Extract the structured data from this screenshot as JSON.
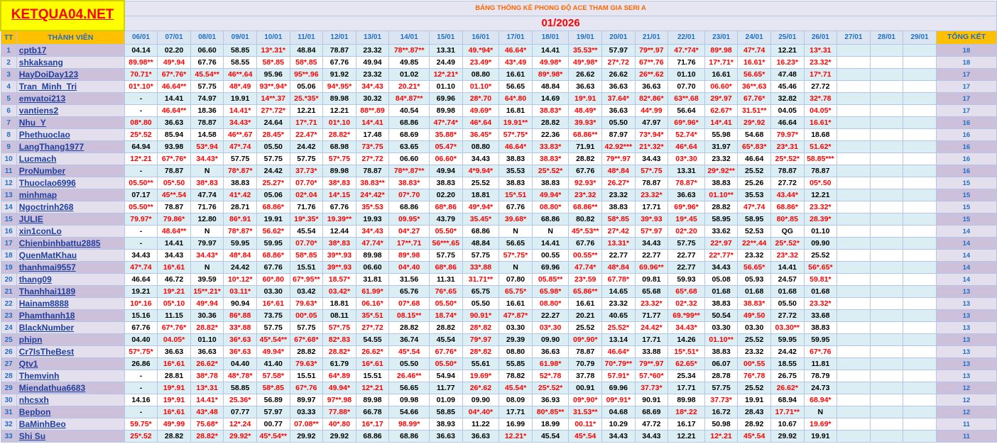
{
  "logo_text": "KETQUA04.NET",
  "sheet_title": "BẢNG THỐNG KÊ PHONG ĐỘ ACE THAM GIA SERI A",
  "month": "01/2026",
  "headers": {
    "tt": "TT",
    "member": "THÀNH VIÊN",
    "total": "TỔNG KẾT"
  },
  "dates": [
    "06/01",
    "07/01",
    "08/01",
    "09/01",
    "10/01",
    "11/01",
    "12/01",
    "13/01",
    "14/01",
    "15/01",
    "16/01",
    "17/01",
    "18/01",
    "19/01",
    "20/01",
    "21/01",
    "22/01",
    "23/01",
    "24/01",
    "25/01",
    "26/01",
    "27/01",
    "28/01",
    "29/01"
  ],
  "rows": [
    {
      "tt": "1",
      "name": "cptb17",
      "cells": [
        "04.14",
        "02.20",
        "06.60",
        "58.85",
        "13*.31*",
        "48.84",
        "78.87",
        "23.32",
        "78**.87**",
        "13.31",
        "49.*94*",
        "46.64*",
        "14.41",
        "35.53**",
        "57.97",
        "79**.97",
        "47.*74*",
        "89*.98",
        "47*.74",
        "12.21",
        "13*.31",
        "",
        "",
        ""
      ],
      "total": "18"
    },
    {
      "tt": "2",
      "name": "shkaksang",
      "cells": [
        "89.98**",
        "49*.94",
        "67.76",
        "58.55",
        "58*.85",
        "58*.85",
        "67.76",
        "49.94",
        "49.85",
        "24.49",
        "23.49*",
        "43*.49",
        "49.98*",
        "49*.98*",
        "27*.72",
        "67**.76",
        "71.76",
        "17*.71*",
        "16.61*",
        "16.23*",
        "23.32*",
        "",
        "",
        ""
      ],
      "total": "18"
    },
    {
      "tt": "3",
      "name": "HayDoiDay123",
      "cells": [
        "70.71*",
        "67*.76*",
        "45.54**",
        "46**.64",
        "95.96",
        "95**.96",
        "91.92",
        "23.32",
        "01.02",
        "12*.21*",
        "08.80",
        "16.61",
        "89*.98*",
        "26.62",
        "26.62",
        "26**.62",
        "01.10",
        "16.61",
        "56.65*",
        "47.48",
        "17*.71",
        "",
        "",
        ""
      ],
      "total": "17"
    },
    {
      "tt": "4",
      "name": "Tran_Minh_Tri",
      "cells": [
        "01*.10*",
        "46.64**",
        "57.75",
        "48*.49",
        "93**.94*",
        "05.06",
        "94*.95*",
        "34*.43",
        "20.21*",
        "01.10",
        "01.10*",
        "56.65",
        "48.84",
        "36.63",
        "36.63",
        "36.63",
        "07.70",
        "06.60*",
        "36**.63",
        "45.46",
        "27.72",
        "",
        "",
        ""
      ],
      "total": "17"
    },
    {
      "tt": "5",
      "name": "emvatoi213",
      "cells": [
        "-",
        "14.41",
        "74.97",
        "19.91",
        "14**.37",
        "25.*35*",
        "89.98",
        "30.32",
        "84*.87**",
        "69.96",
        "28*.70",
        "64*.80",
        "14.69",
        "19*.91",
        "37.64*",
        "82*.86*",
        "63**.68",
        "29*.97",
        "67.76*",
        "32.82",
        "32*.78",
        "",
        "",
        ""
      ],
      "total": "17"
    },
    {
      "tt": "6",
      "name": "vantiens2",
      "cells": [
        "-",
        "46.64**",
        "18.36",
        "14.41*",
        "27*.72*",
        "12.21",
        "12.21",
        "88**.89",
        "40.54",
        "89.98",
        "49.69*",
        "16.81",
        "38.83*",
        "48.49*",
        "36.63",
        "44*.99",
        "56.64",
        "62.67*",
        "31.51**",
        "04.05",
        "04.05*",
        "",
        "",
        ""
      ],
      "total": "17"
    },
    {
      "tt": "7",
      "name": "Nhu_Y",
      "cells": [
        "08*.80",
        "36.63",
        "78.87",
        "34.43*",
        "24.64",
        "17*.71",
        "01*.10",
        "14*.41",
        "68.86",
        "47*.74*",
        "46*.64",
        "19.91**",
        "28.82",
        "39.93*",
        "05.50",
        "47.97",
        "69*.96*",
        "14*.41",
        "29*.92",
        "46.64",
        "16.61*",
        "",
        "",
        ""
      ],
      "total": "16"
    },
    {
      "tt": "8",
      "name": "Phethuoclao",
      "cells": [
        "25*.52",
        "85.94",
        "14.58",
        "46**.67",
        "28.45*",
        "22.47*",
        "28.82*",
        "17.48",
        "68.69",
        "35.88*",
        "36.45*",
        "57*.75*",
        "22.36",
        "68.86**",
        "87.97",
        "73*.94*",
        "52.74*",
        "55.98",
        "54.68",
        "79.97*",
        "18.68",
        "",
        "",
        ""
      ],
      "total": "16"
    },
    {
      "tt": "9",
      "name": "LangThang1977",
      "cells": [
        "64.94",
        "93.98",
        "53*.94",
        "47*.74",
        "05.50",
        "24.42",
        "68.98",
        "73*.75",
        "63.65",
        "05.47*",
        "08.80",
        "46.64*",
        "33.83*",
        "71.91",
        "42.92***",
        "21*.32*",
        "46*.64",
        "31.97",
        "65*.83*",
        "23*.31",
        "51.62*",
        "",
        "",
        ""
      ],
      "total": "16"
    },
    {
      "tt": "10",
      "name": "Lucmach",
      "cells": [
        "12*.21",
        "67*.76*",
        "34.43*",
        "57.75",
        "57.75",
        "57.75",
        "57*.75",
        "27*.72",
        "06.60",
        "06.60*",
        "34.43",
        "38.83",
        "38.83*",
        "28.82",
        "79**.97",
        "34.43",
        "03*.30",
        "23.32",
        "46.64",
        "25*.52*",
        "58.85***",
        "",
        "",
        ""
      ],
      "total": "16"
    },
    {
      "tt": "11",
      "name": "ProNumber",
      "cells": [
        "-",
        "78.87",
        "N",
        "78*.87*",
        "24.42",
        "37.73*",
        "89.98",
        "78.87",
        "78**.87**",
        "49.94",
        "4*9.94*",
        "35.53",
        "25*.52*",
        "67.76",
        "48*.84",
        "57*.75",
        "13.31",
        "29*.92**",
        "25.52",
        "78.87",
        "78.87",
        "",
        "",
        ""
      ],
      "total": "16"
    },
    {
      "tt": "12",
      "name": "Thuoclao6996",
      "cells": [
        "05.50**",
        "05*.50",
        "38*.83",
        "38.83",
        "25.27*",
        "07.70*",
        "38*.83",
        "38.83**",
        "38.83*",
        "38.83",
        "25.52",
        "38.83",
        "38.83",
        "92.93*",
        "26.27*",
        "78.87",
        "78.87*",
        "38.83",
        "25.26",
        "27.72",
        "05*.50",
        "",
        "",
        ""
      ],
      "total": "15"
    },
    {
      "tt": "13",
      "name": "minhmap",
      "cells": [
        "07.17",
        "45**.54",
        "47.74",
        "41*.42",
        "05.06",
        "02*.04",
        "14*.15",
        "24*.42*",
        "07*.70",
        "02.20",
        "18.81",
        "15*.51",
        "49.94*",
        "23*.32",
        "23.32",
        "23.32*",
        "36.63",
        "01.10**",
        "35.53",
        "43.44*",
        "12.21",
        "",
        "",
        ""
      ],
      "total": "15"
    },
    {
      "tt": "14",
      "name": "Ngoctrinh268",
      "cells": [
        "05.50**",
        "78.87",
        "71.76",
        "28.71",
        "68.86*",
        "71.76",
        "67.76",
        "35*.53",
        "68.86",
        "68*.86",
        "49*.94*",
        "67.76",
        "08.80*",
        "68.86**",
        "38.83",
        "17.71",
        "69*.96*",
        "28.82",
        "47*.74",
        "68.86*",
        "23.32*",
        "",
        "",
        ""
      ],
      "total": "15"
    },
    {
      "tt": "15",
      "name": "JULIE",
      "cells": [
        "79.97*",
        "79.86*",
        "12.80",
        "86*.91",
        "19.91",
        "19*.35*",
        "19.39**",
        "19.93",
        "09.95*",
        "43.79",
        "35.45*",
        "39.68*",
        "68.86",
        "80.82",
        "58*.85",
        "39*.93",
        "19*.45",
        "58.95",
        "58.95",
        "80*.85",
        "28.39*",
        "",
        "",
        ""
      ],
      "total": "15"
    },
    {
      "tt": "16",
      "name": "xin1conLo",
      "cells": [
        "-",
        "48.64**",
        "N",
        "78*.87*",
        "56.62*",
        "45.54",
        "12.44",
        "34*.43",
        "04*.27",
        "05.50*",
        "68.86",
        "N",
        "N",
        "45*.53**",
        "27*.42",
        "57*.97",
        "02*.20",
        "33.62",
        "52.53",
        "QG",
        "01.10",
        "",
        "",
        ""
      ],
      "total": "14"
    },
    {
      "tt": "17",
      "name": "Chienbinhbattu2885",
      "cells": [
        "-",
        "14.41",
        "79.97",
        "59.95",
        "59.95",
        "07.70*",
        "38*.83",
        "47.74*",
        "17**.71",
        "56***.65",
        "48.84",
        "56.65",
        "14.41",
        "67.76",
        "13.31*",
        "34.43",
        "57.75",
        "22*.97",
        "22**.44",
        "25*.52*",
        "09.90",
        "",
        "",
        ""
      ],
      "total": "14"
    },
    {
      "tt": "18",
      "name": "QuenMatKhau",
      "cells": [
        "34.43",
        "34.43",
        "34.43*",
        "48*.84",
        "68.86*",
        "58*.85",
        "39**.93",
        "89.98",
        "89*.98",
        "57.75",
        "57.75",
        "57*.75*",
        "00.55",
        "00.55**",
        "22.77",
        "22.77",
        "22.77",
        "22*.77*",
        "23.32",
        "23*.32",
        "25.52",
        "",
        "",
        ""
      ],
      "total": "14"
    },
    {
      "tt": "19",
      "name": "thanhmai9557",
      "cells": [
        "47*.74",
        "16*.61",
        "N",
        "24.42",
        "67.76",
        "15.51",
        "39**.93",
        "06.60",
        "04*.40",
        "68*.86",
        "33*.88",
        "N",
        "69.96",
        "47.74*",
        "48*.84",
        "69.96**",
        "22.77",
        "34.43",
        "56.65*",
        "14.41",
        "56*.65*",
        "",
        "",
        ""
      ],
      "total": "14"
    },
    {
      "tt": "20",
      "name": "thang09",
      "cells": [
        "46.64",
        "46.72",
        "39.59",
        "10*.12*",
        "60*.80",
        "67*.95**",
        "18.57*",
        "31.81",
        "31.56",
        "11.31",
        "31.71**",
        "07.80",
        "05.85**",
        "23*.59",
        "67.78*",
        "09.81",
        "59.93",
        "05.08",
        "05.93",
        "24.57",
        "59.81*",
        "",
        "",
        ""
      ],
      "total": "14"
    },
    {
      "tt": "21",
      "name": "Thanhhai1189",
      "cells": [
        "19.21",
        "19*.21",
        "15**.21*",
        "03.11*",
        "03.30",
        "03.42",
        "03.42*",
        "61.99*",
        "65.76",
        "76*.65",
        "65.75",
        "65.75*",
        "65.98*",
        "65.86**",
        "14.65",
        "65.68",
        "65*.68",
        "01.68",
        "01.68",
        "01.68",
        "01.68",
        "",
        "",
        ""
      ],
      "total": "13"
    },
    {
      "tt": "22",
      "name": "Hainam8888",
      "cells": [
        "10*.16",
        "05*.10",
        "49*.94",
        "90.94",
        "16*.61",
        "79.63*",
        "18.81",
        "06.16*",
        "07*.68",
        "05.50*",
        "05.50",
        "16.61",
        "08.80*",
        "16.61",
        "23.32",
        "23.32*",
        "02*.32",
        "38.83",
        "38.83*",
        "05.50",
        "23.32*",
        "",
        "",
        ""
      ],
      "total": "13"
    },
    {
      "tt": "23",
      "name": "Phamthanh18",
      "cells": [
        "15.16",
        "11.15",
        "30.36",
        "86*.88",
        "73.75",
        "00*.05",
        "08.11",
        "35*.51",
        "08.15**",
        "18.74*",
        "90.91*",
        "47*.87*",
        "22.27",
        "20.21",
        "40.65",
        "71.77",
        "69.*99**",
        "50.54",
        "49*.50",
        "27.72",
        "33.68",
        "",
        "",
        ""
      ],
      "total": "13"
    },
    {
      "tt": "24",
      "name": "BlackNumber",
      "cells": [
        "67.76",
        "67*.76*",
        "28.82*",
        "33*.88",
        "57.75",
        "57.75",
        "57*.75",
        "27*.72",
        "28.82",
        "28.82",
        "28*.82",
        "03.30",
        "03*.30",
        "25.52",
        "25.52*",
        "24.42*",
        "34.43*",
        "03.30",
        "03.30",
        "03.30**",
        "38.83",
        "",
        "",
        ""
      ],
      "total": "13"
    },
    {
      "tt": "25",
      "name": "phipn",
      "cells": [
        "04.40",
        "04.05*",
        "01.10",
        "36*.63",
        "45*.54**",
        "67*.68*",
        "82*.83",
        "54.55",
        "36.74",
        "45.54",
        "79*.97",
        "29.39",
        "09.90",
        "09*.90*",
        "13.14",
        "17.71",
        "14.26",
        "01.10**",
        "25.52",
        "59.95",
        "59.95",
        "",
        "",
        ""
      ],
      "total": "13"
    },
    {
      "tt": "26",
      "name": "Cr7IsTheBest",
      "cells": [
        "57*.75*",
        "36.63",
        "36.63",
        "36*.63",
        "49.94*",
        "28.82",
        "28.82*",
        "26.62*",
        "45*.54",
        "67.76*",
        "28*.82",
        "08.80",
        "36.63",
        "78.87",
        "46.64*",
        "33.88",
        "15*.51*",
        "38.83",
        "23.32",
        "24.42",
        "67*.76",
        "",
        "",
        ""
      ],
      "total": "13"
    },
    {
      "tt": "27",
      "name": "Qtv1",
      "cells": [
        "26.86",
        "16*.61",
        "26.62*",
        "04.40",
        "41.40",
        "79.63*",
        "61.79",
        "16*.61",
        "05.50",
        "05.50*",
        "55.61",
        "55.85",
        "61.98*",
        "70.79",
        "70*.79**",
        "79**.97",
        "62.65*",
        "06.07",
        "00*.55",
        "18.55",
        "11.81",
        "",
        "",
        ""
      ],
      "total": "13"
    },
    {
      "tt": "28",
      "name": "Themvinh",
      "cells": [
        "-",
        "28.81",
        "38*.78",
        "48*.78*",
        "57.58*",
        "15.51",
        "64*.89",
        "15.51",
        "26.46**",
        "54.94",
        "19.69*",
        "78.82",
        "52*.78",
        "37.78",
        "57.91*",
        "57.*60*",
        "25.34",
        "28.78",
        "76*.78",
        "26.75",
        "78.79",
        "",
        "",
        ""
      ],
      "total": "13"
    },
    {
      "tt": "29",
      "name": "Miendathua6683",
      "cells": [
        "-",
        "19*.91",
        "13*.31",
        "58.85",
        "58*.85",
        "67*.76",
        "49.94*",
        "12*.21",
        "56.65",
        "11.77",
        "26*.62",
        "45.54*",
        "25*.52*",
        "00.91",
        "69.96",
        "37.73*",
        "17.71",
        "57.75",
        "25.52",
        "26.62*",
        "24.73",
        "",
        "",
        ""
      ],
      "total": "12"
    },
    {
      "tt": "30",
      "name": "nhcsxh",
      "cells": [
        "14.16",
        "19*.91",
        "14.41*",
        "25.36*",
        "56.89",
        "89.97",
        "97**.98",
        "89.98",
        "09.98",
        "01.09",
        "09.90",
        "08.09",
        "36.93",
        "09*.90*",
        "09*.91*",
        "90.91",
        "89.98",
        "37.73*",
        "19.91",
        "68.94",
        "68.94*",
        "",
        "",
        ""
      ],
      "total": "12"
    },
    {
      "tt": "31",
      "name": "Bepbon",
      "cells": [
        "-",
        "16*.61",
        "43*.48",
        "07.77",
        "57.97",
        "03.33",
        "77.88*",
        "66.78",
        "54.66",
        "58.85",
        "04*.40*",
        "17.71",
        "80*.85**",
        "31.53**",
        "04.68",
        "68.69",
        "18*.22",
        "16.72",
        "28.43",
        "17.71**",
        "N",
        "",
        "",
        ""
      ],
      "total": "12"
    },
    {
      "tt": "32",
      "name": "BaMinhBeo",
      "cells": [
        "59.75*",
        "49*.99",
        "75.68*",
        "12*.24",
        "00.77",
        "07.08**",
        "40*.80",
        "16*.17",
        "98.99*",
        "38.93",
        "11.22",
        "16.99",
        "18.99",
        "00.11*",
        "10.29",
        "47.72",
        "16.17",
        "50.98",
        "28.92",
        "10.67",
        "19.69*",
        "",
        "",
        ""
      ],
      "total": "11"
    },
    {
      "tt": "33",
      "name": "Shi Su",
      "cells": [
        "25*.52",
        "28.82",
        "28.82*",
        "29.92*",
        "45*.54**",
        "29.92",
        "29.92",
        "68.86",
        "68.86",
        "36.63",
        "36.63",
        "12.21*",
        "45.54",
        "45*.54",
        "34.43",
        "34.43",
        "12.21",
        "12*.21",
        "45*.54",
        "29.92",
        "19.91",
        "",
        "",
        ""
      ],
      "total": "11"
    }
  ]
}
